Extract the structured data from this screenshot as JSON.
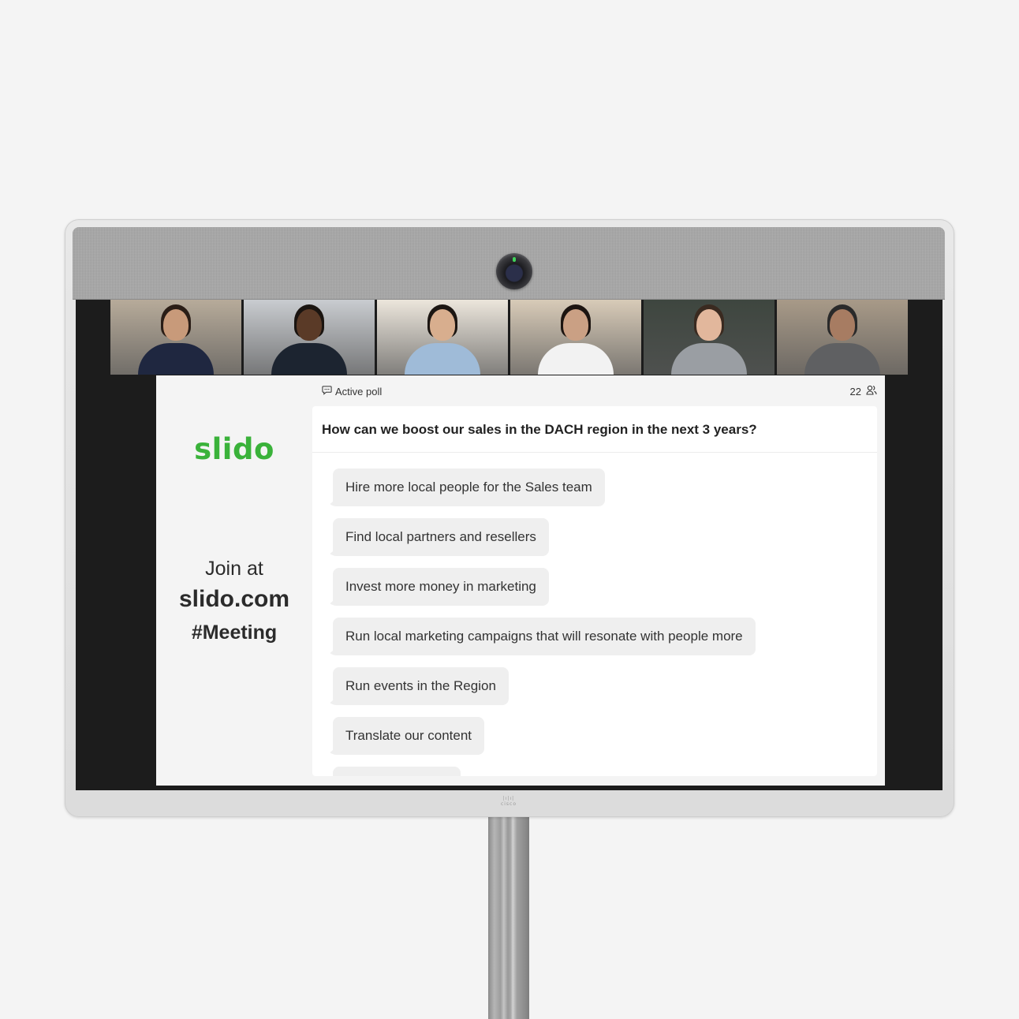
{
  "device": {
    "brand_label": "cisco",
    "camera_status_color": "#3fd35a"
  },
  "video_participants": [
    {
      "name": "participant-1",
      "bg": "#b7ab9a",
      "skin": "#c89a7a",
      "hair": "#2a1d16",
      "shirt": "#1f2740"
    },
    {
      "name": "participant-2",
      "bg": "#c9ccd0",
      "skin": "#5a3a27",
      "hair": "#1a1410",
      "shirt": "#1c2430"
    },
    {
      "name": "participant-3",
      "bg": "#ece6dc",
      "skin": "#d8ae8e",
      "hair": "#1c1612",
      "shirt": "#9fbbd8"
    },
    {
      "name": "participant-4",
      "bg": "#d8cbb8",
      "skin": "#caa084",
      "hair": "#1c1410",
      "shirt": "#f2f2f2"
    },
    {
      "name": "participant-5",
      "bg": "#3e463f",
      "skin": "#e2b79c",
      "hair": "#3a2a20",
      "shirt": "#9a9ea3"
    },
    {
      "name": "participant-6",
      "bg": "#a89a88",
      "skin": "#a77c62",
      "hair": "#2a2a2a",
      "shirt": "#5f6062"
    }
  ],
  "slide": {
    "logo": "slido",
    "brand_color": "#3ab23a",
    "join_at": "Join at",
    "join_url": "slido.com",
    "event_code": "#Meeting"
  },
  "poll": {
    "status_label": "Active poll",
    "participant_count": "22",
    "question": "How can we boost our sales in the DACH region in the next 3 years?",
    "answers": [
      "Hire more local people for the Sales team",
      "Find local partners and resellers",
      "Invest more money in marketing",
      "Run local marketing campaigns that will resonate with people more",
      "Run events in the Region",
      "Translate our content",
      ""
    ]
  }
}
